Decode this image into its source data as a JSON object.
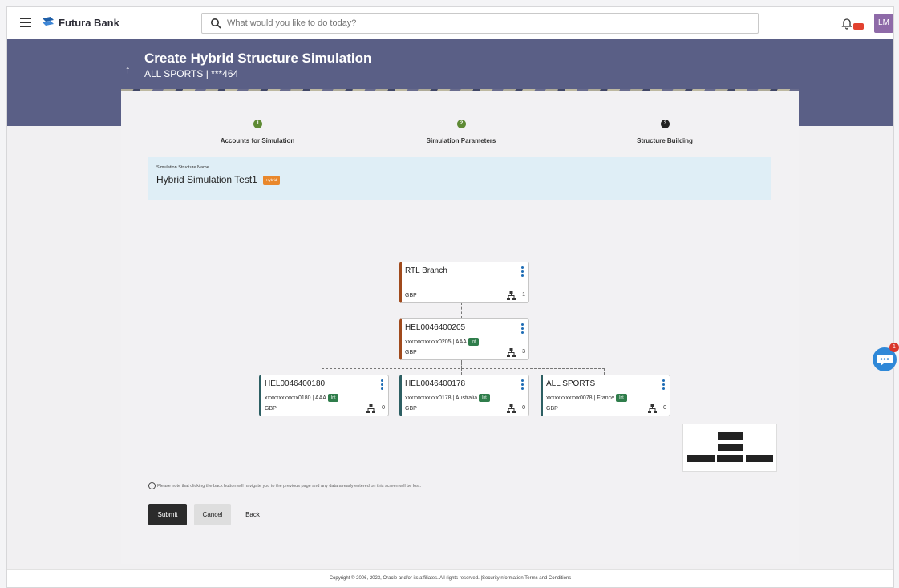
{
  "header": {
    "brand": "Futura Bank",
    "search_placeholder": "What would you like to do today?",
    "notification_badge": "99+",
    "avatar_initials": "LM"
  },
  "banner": {
    "title": "Create Hybrid Structure Simulation",
    "subtitle": "ALL SPORTS | ***464"
  },
  "stepper": {
    "steps": [
      {
        "number": "1",
        "label": "Accounts for Simulation",
        "state": "done"
      },
      {
        "number": "2",
        "label": "Simulation Parameters",
        "state": "done"
      },
      {
        "number": "3",
        "label": "Structure Building",
        "state": "current"
      }
    ]
  },
  "structure": {
    "name_label": "Simulation Structure Name",
    "name": "Hybrid Simulation Test1",
    "badge": "Hybrid"
  },
  "tree": {
    "root": {
      "title": "RTL Branch",
      "currency": "GBP",
      "children_count": "1"
    },
    "level1": {
      "title": "HEL0046400205",
      "account": "xxxxxxxxxxxx0205 | AAA",
      "badge": "Int",
      "currency": "GBP",
      "children_count": "3"
    },
    "level2": [
      {
        "title": "HEL0046400180",
        "account": "xxxxxxxxxxxx0180 | AAA",
        "badge": "Int",
        "currency": "GBP",
        "children_count": "0"
      },
      {
        "title": "HEL0046400178",
        "account": "xxxxxxxxxxxx0178 | Australia",
        "badge": "Int",
        "currency": "GBP",
        "children_count": "0"
      },
      {
        "title": "ALL SPORTS",
        "account": "xxxxxxxxxxxx0078 | France",
        "badge": "Int",
        "currency": "GBP",
        "children_count": "0"
      }
    ]
  },
  "note": "Please note that clicking the back button will navigate you to the previous page and any data already entered on this screen will be lost.",
  "buttons": {
    "submit": "Submit",
    "cancel": "Cancel",
    "back": "Back"
  },
  "chat": {
    "badge": "1"
  },
  "footer": "Copyright © 2006, 2023, Oracle and/or its affiliates. All rights reserved. |SecurityInformation|Terms and Conditions",
  "colors": {
    "banner": "#5a5f86",
    "step_done": "#5e8a34",
    "int_badge": "#2f7d4b",
    "hybrid_badge": "#e9872b",
    "link_blue": "#1f6db5"
  }
}
